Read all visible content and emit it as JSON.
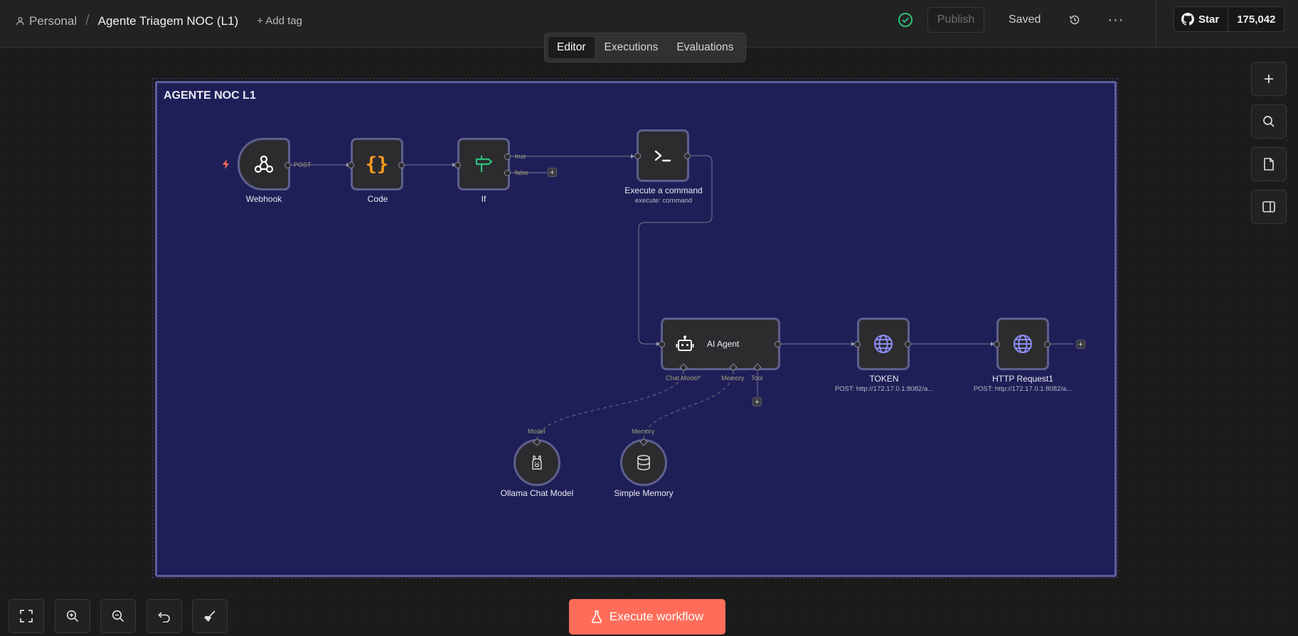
{
  "topbar": {
    "owner": "Personal",
    "separator": "/",
    "workflow_title": "Agente Triagem NOC (L1)",
    "add_tag": "+ Add tag",
    "publish": "Publish",
    "status": "Saved",
    "more": "···",
    "github_star": "Star",
    "github_count": "175,042"
  },
  "tabs": [
    {
      "label": "Editor",
      "active": true
    },
    {
      "label": "Executions",
      "active": false
    },
    {
      "label": "Evaluations",
      "active": false
    }
  ],
  "sticky": {
    "title": "AGENTE NOC L1",
    "color": "#1f1f58"
  },
  "nodes": {
    "webhook": {
      "label": "Webhook",
      "output": "POST"
    },
    "code": {
      "label": "Code"
    },
    "if": {
      "label": "If",
      "true_label": "true",
      "false_label": "false"
    },
    "execute_command": {
      "label": "Execute a command",
      "sublabel": "execute: command"
    },
    "ai_agent": {
      "label": "AI Agent",
      "chat_model": "Chat Model*",
      "memory": "Memory",
      "tool": "Tool"
    },
    "token": {
      "label": "TOKEN",
      "sublabel": "POST: http://172.17.0.1:8082/a..."
    },
    "http_request": {
      "label": "HTTP Request1",
      "sublabel": "POST: http://172.17.0.1:8082/a..."
    },
    "ollama": {
      "label": "Ollama Chat Model",
      "input": "Model"
    },
    "memory": {
      "label": "Simple Memory",
      "input": "Memory"
    }
  },
  "execute_button": "Execute workflow",
  "colors": {
    "accent": "#ff6d5a",
    "sticky_border": "#5e5fa0",
    "node_border": "#5f5f8f",
    "success": "#2dbf77",
    "code_icon": "#f79b1c",
    "if_icon": "#2dbf77",
    "globe_icon": "#8b8cf5"
  },
  "icons": {
    "rail": [
      "plus-icon",
      "search-icon",
      "sticky-note-icon",
      "panel-icon"
    ],
    "bottom": [
      "fit-view-icon",
      "zoom-in-icon",
      "zoom-out-icon",
      "undo-icon",
      "tidy-up-icon"
    ]
  }
}
